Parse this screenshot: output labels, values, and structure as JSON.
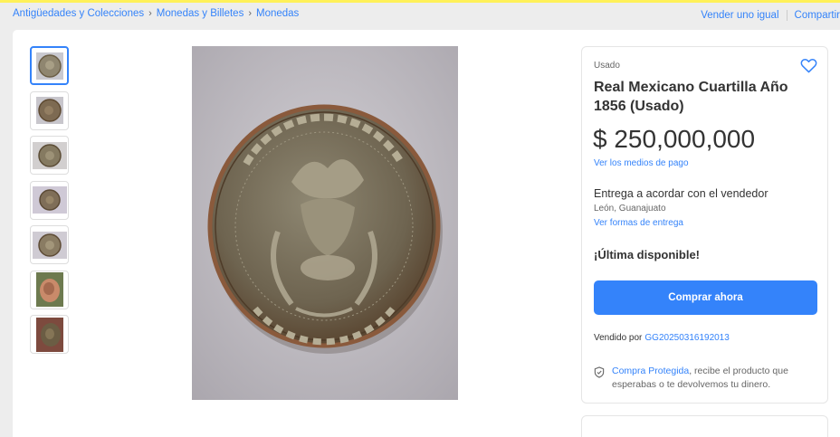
{
  "breadcrumb": {
    "items": [
      "Antigüedades y Colecciones",
      "Monedas y Billetes",
      "Monedas"
    ],
    "separator": "›"
  },
  "header_actions": {
    "sell": "Vender uno igual",
    "share": "Compartir"
  },
  "gallery": {
    "thumbnails": [
      "coin-photo-1",
      "coin-photo-2",
      "coin-photo-3",
      "coin-photo-4",
      "coin-photo-5",
      "coin-photo-6",
      "coin-photo-7"
    ],
    "selected_index": 0,
    "main_image": "coin-photo-1"
  },
  "product": {
    "condition": "Usado",
    "title": "Real Mexicano Cuartilla Año 1856 (Usado)",
    "price": "$ 250,000,000",
    "payment_link": "Ver los medios de pago",
    "shipping": "Entrega a acordar con el vendedor",
    "location": "León, Guanajuato",
    "shipping_link": "Ver formas de entrega",
    "stock": "¡Última disponible!",
    "buy_button": "Comprar ahora",
    "sold_by_label": "Vendido por",
    "seller": "GG20250316192013",
    "protection_link": "Compra Protegida",
    "protection_text": ", recibe el producto que esperabas o te devolvemos tu dinero."
  },
  "colors": {
    "accent": "#3483fa",
    "header_yellow": "#fff159",
    "background": "#ededed"
  }
}
